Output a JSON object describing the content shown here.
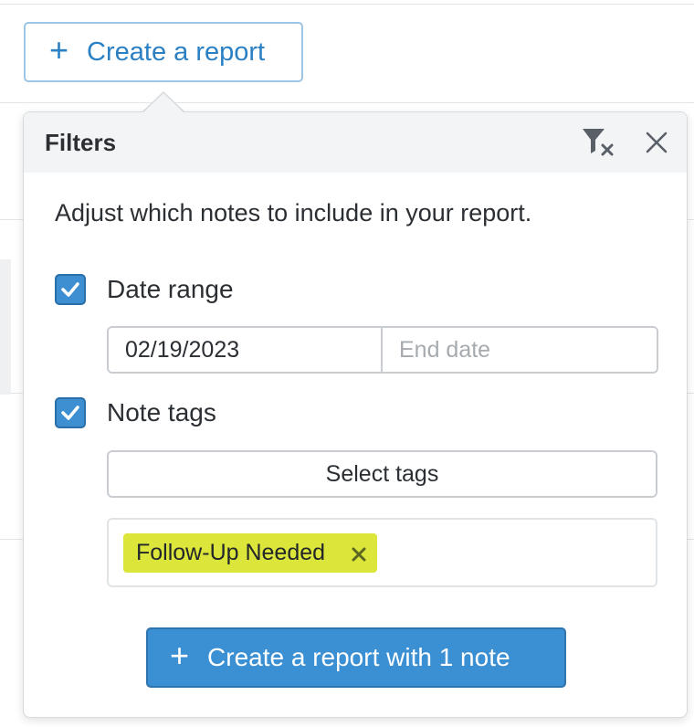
{
  "toolbar": {
    "create_report_label": "Create a report",
    "create_icon": "plus-icon"
  },
  "filters_popover": {
    "title": "Filters",
    "clear_filters_icon": "filter-clear-icon",
    "close_icon": "close-icon",
    "description": "Adjust which notes to include in your report.",
    "date_range": {
      "checked": true,
      "label": "Date range",
      "start_value": "02/19/2023",
      "end_placeholder": "End date"
    },
    "note_tags": {
      "checked": true,
      "label": "Note tags",
      "select_label": "Select tags",
      "selected_tags": [
        {
          "label": "Follow-Up Needed",
          "color": "#dbe53a"
        }
      ]
    },
    "submit_label": "Create a report with 1 note"
  },
  "colors": {
    "accent": "#3b8fd3",
    "accent_text": "#2b80c4",
    "tag": "#dbe53a"
  }
}
